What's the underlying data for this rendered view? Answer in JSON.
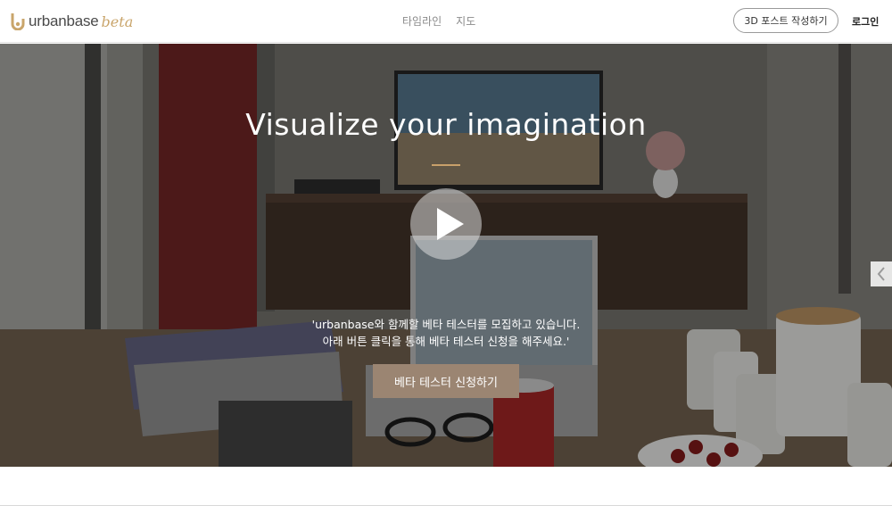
{
  "brand": {
    "name": "urbanbase",
    "badge": "beta",
    "logo_color": "#c9a56b"
  },
  "nav": {
    "items": [
      {
        "label": "타임라인"
      },
      {
        "label": "지도"
      }
    ]
  },
  "header_actions": {
    "write_post_label": "3D 포스트 작성하기",
    "login_label": "로그인"
  },
  "hero": {
    "title": "Visualize your imagination",
    "description_line1": "'urbanbase와 함께할 베타 테스터를 모집하고 있습니다.",
    "description_line2": "아래 버튼 클릭을 통해 베타 테스터 신청을 해주세요.'",
    "apply_button_label": "베타 테스터 신청하기",
    "play_icon": "play-icon",
    "next_arrow_icon": "chevron-left-icon",
    "accent_color": "#c8a06a",
    "button_color": "#9b8572"
  }
}
